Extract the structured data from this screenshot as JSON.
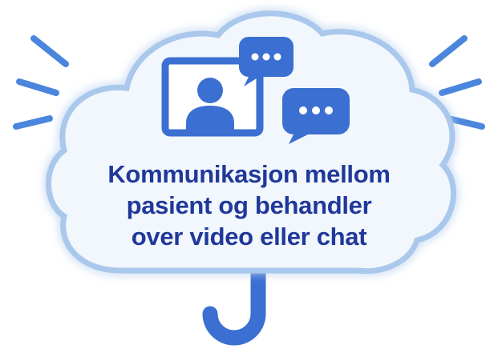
{
  "caption": {
    "lines": [
      "Kommunikasjon mellom",
      "pasient og behandler",
      "over video eller chat"
    ]
  },
  "icons": {
    "video": "video-call-person-icon",
    "chat": "chat-bubble-icon"
  },
  "colors": {
    "primary": "#3b6fd1",
    "cloud_border": "#a9c8ec",
    "cloud_fill": "#f2f7fd",
    "text": "#20389a",
    "accent_lines": "#4a86dd"
  }
}
